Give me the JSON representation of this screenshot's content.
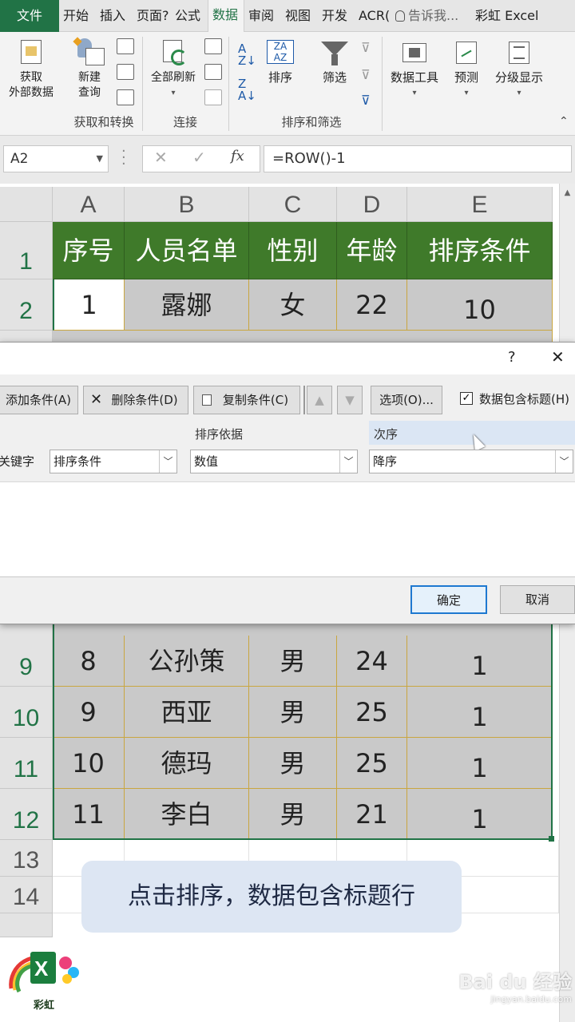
{
  "ribbon_tabs": {
    "file": "文件",
    "home": "开始",
    "insert": "插入",
    "page_layout": "页面?",
    "formulas": "公式",
    "data": "数据",
    "review": "审阅",
    "view": "视图",
    "developer": "开发",
    "acrobat": "ACR(",
    "tell_me": "告诉我...",
    "caihong": "彩虹 Excel"
  },
  "ribbon": {
    "get_external_data": "获取\n外部数据",
    "new_query": "新建\n查询",
    "group_get_transform": "获取和转换",
    "refresh_all": "全部刷新",
    "group_connections": "连接",
    "sort": "排序",
    "filter": "筛选",
    "group_sort_filter": "排序和筛选",
    "data_tools": "数据工具",
    "forecast": "预测",
    "outline": "分级显示"
  },
  "formula_bar": {
    "name_box": "A2",
    "cancel_symbol": "✕",
    "enter_symbol": "✓",
    "fx_symbol": "fx",
    "formula": "=ROW()-1"
  },
  "sheet": {
    "columns": [
      "A",
      "B",
      "C",
      "D",
      "E"
    ],
    "header_row": [
      "序号",
      "人员名单",
      "性别",
      "年龄",
      "排序条件"
    ],
    "row2": {
      "num": "2",
      "cells": [
        "1",
        "露娜",
        "女",
        "22",
        "10"
      ]
    },
    "lower_rows": [
      {
        "num": "9",
        "cells": [
          "8",
          "公孙策",
          "男",
          "24",
          "1"
        ]
      },
      {
        "num": "10",
        "cells": [
          "9",
          "西亚",
          "男",
          "25",
          "1"
        ]
      },
      {
        "num": "11",
        "cells": [
          "10",
          "德玛",
          "男",
          "25",
          "1"
        ]
      },
      {
        "num": "12",
        "cells": [
          "11",
          "李白",
          "男",
          "21",
          "1"
        ]
      }
    ],
    "row1_num": "1",
    "empty_rows": [
      "13",
      "14"
    ]
  },
  "sort_dialog": {
    "help": "?",
    "close": "✕",
    "add_condition": "添加条件(A)",
    "delete_condition": "删除条件(D)",
    "copy_condition": "复制条件(C)",
    "options": "选项(O)...",
    "has_headers": "数据包含标题(H)",
    "has_headers_checked": true,
    "col_key": "关键字",
    "col_sort_on": "排序依据",
    "col_order": "次序",
    "key_value": "排序条件",
    "sort_on_value": "数值",
    "order_value": "降序",
    "ok": "确定",
    "cancel": "取消"
  },
  "caption": "点击排序，数据包含标题行",
  "logo_text": "彩虹",
  "watermark": {
    "brand": "Bai du 经验",
    "url": "jingyan.baidu.com"
  },
  "colors": {
    "excel_green": "#217346",
    "header_fill": "#3f7a2a",
    "data_fill": "#c9c9c9",
    "cell_border": "#c9a640"
  }
}
